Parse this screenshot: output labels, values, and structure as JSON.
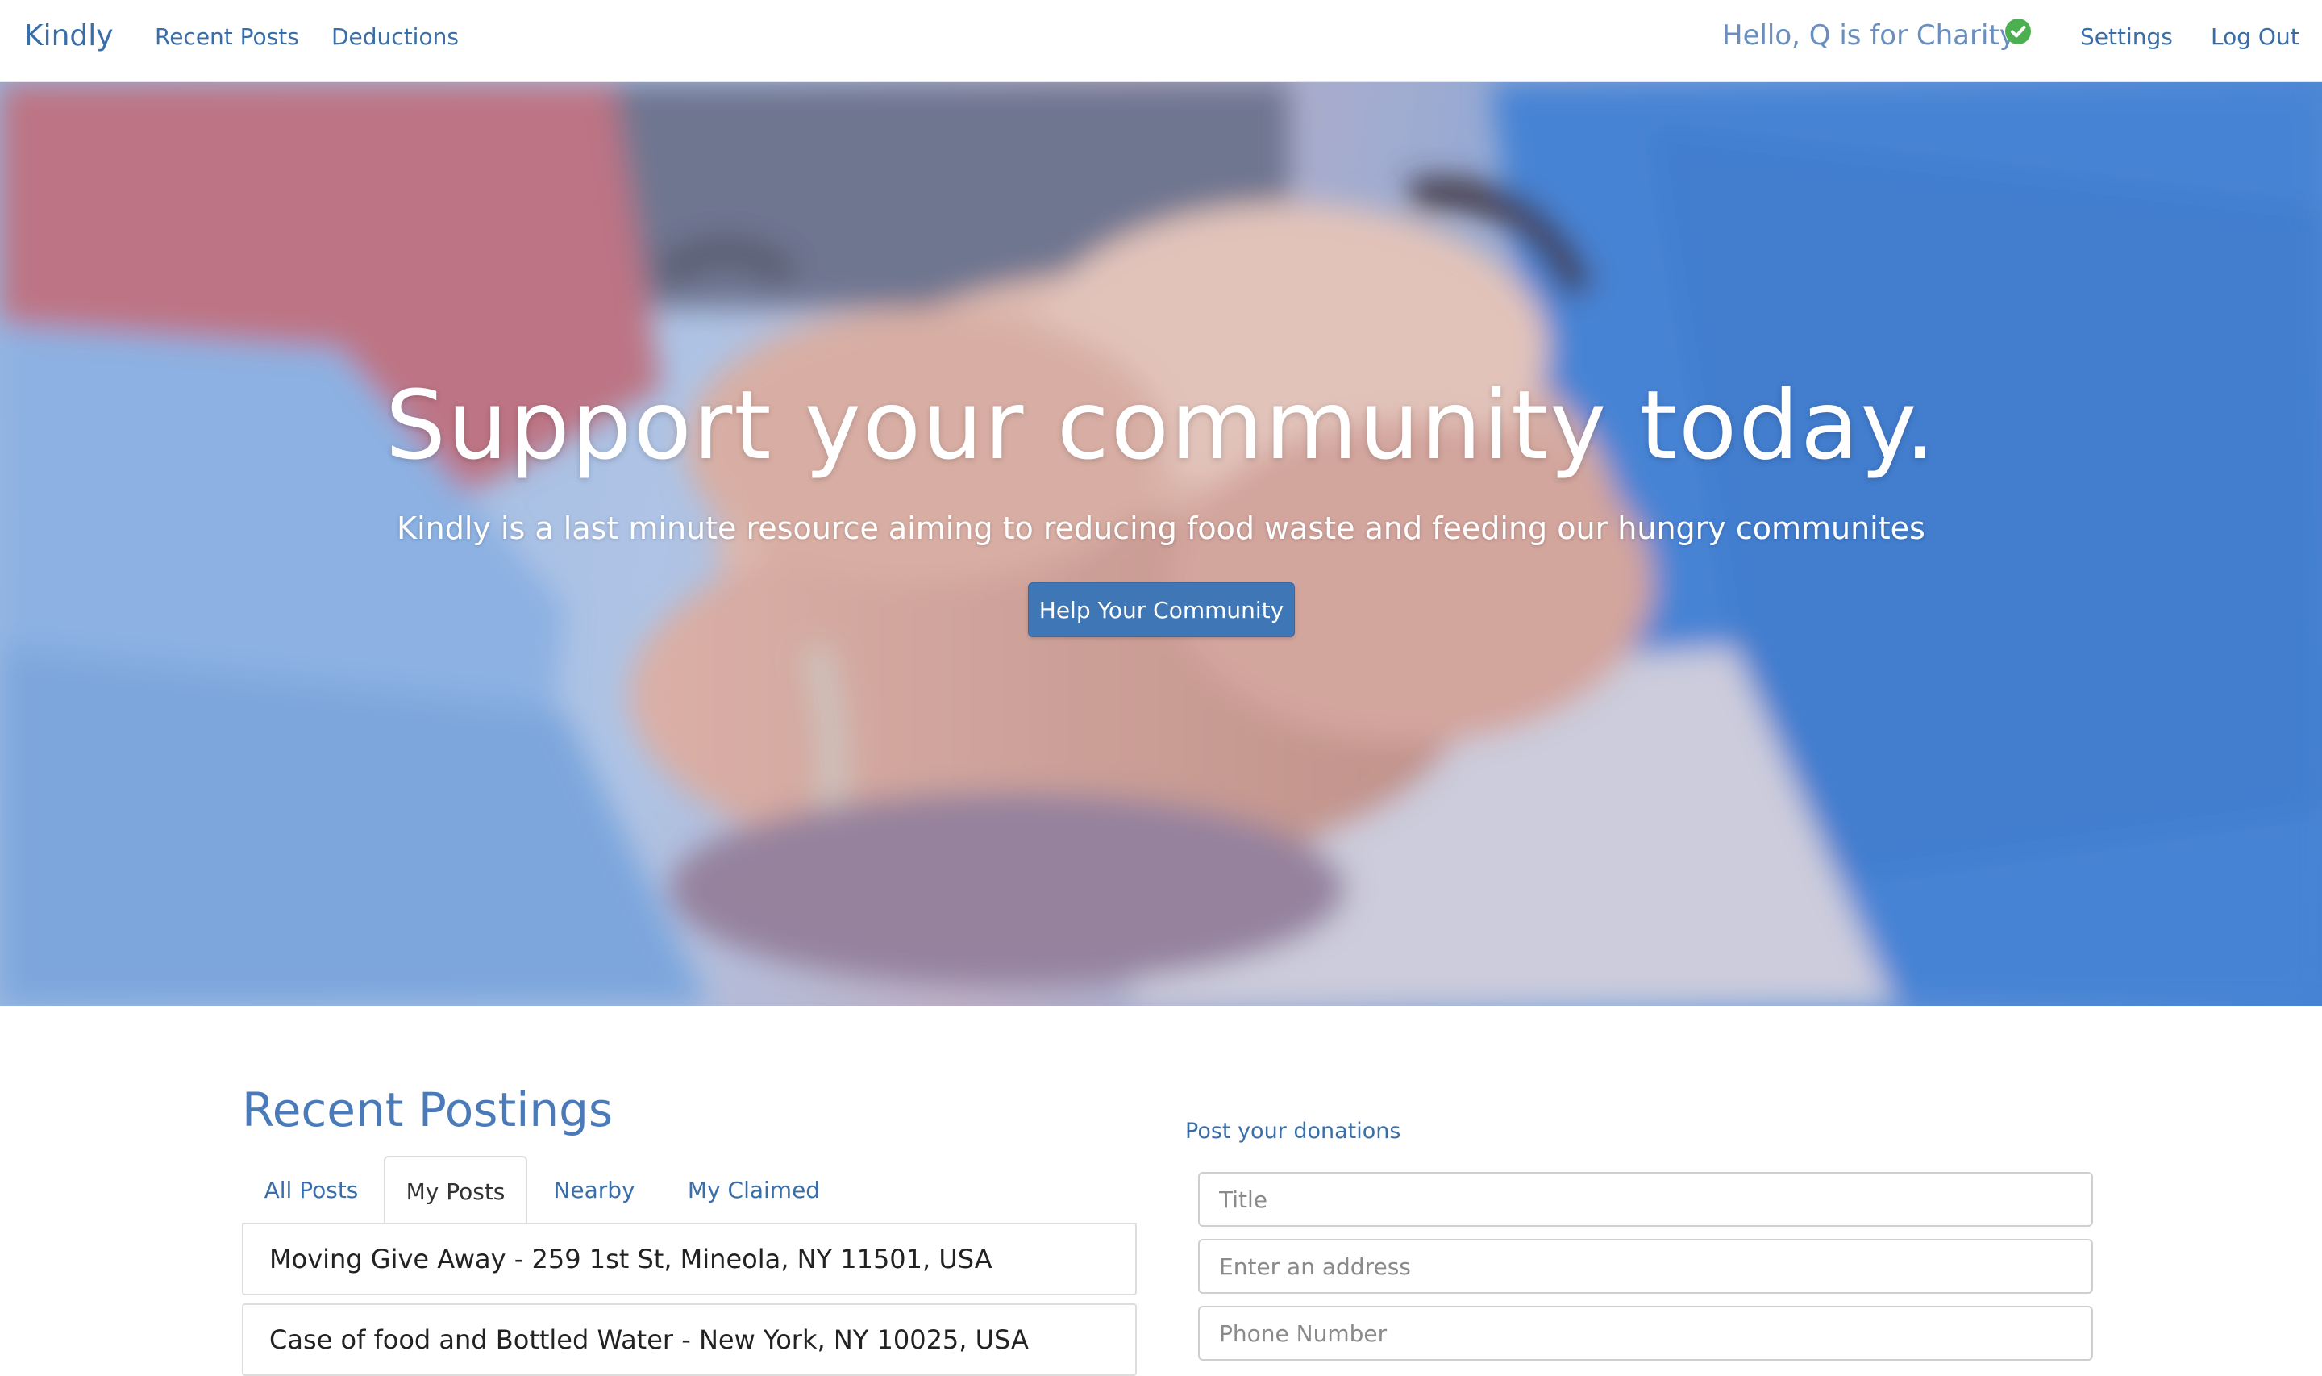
{
  "navbar": {
    "brand": "Kindly",
    "links": [
      "Recent Posts",
      "Deductions"
    ],
    "greeting": "Hello, Q is for Charity",
    "verified_icon": "check-circle-icon",
    "settings": "Settings",
    "logout": "Log Out"
  },
  "hero": {
    "title": "Support your community today.",
    "subtitle": "Kindly is a last minute resource aiming to reducing food waste and feeding our hungry communites",
    "button": "Help Your Community"
  },
  "postings": {
    "title": "Recent Postings",
    "tabs": [
      "All Posts",
      "My Posts",
      "Nearby",
      "My Claimed"
    ],
    "active_tab": "My Posts",
    "items": [
      "Moving Give Away - 259 1st St, Mineola, NY 11501, USA",
      "Case of food and Bottled Water - New York, NY 10025, USA"
    ]
  },
  "donation_form": {
    "title": "Post your donations",
    "title_placeholder": "Title",
    "address_placeholder": "Enter an address",
    "phone_placeholder": "Phone Number"
  },
  "colors": {
    "accent": "#3a6ea8",
    "button": "#3f77b6",
    "verified": "#4caf50"
  }
}
